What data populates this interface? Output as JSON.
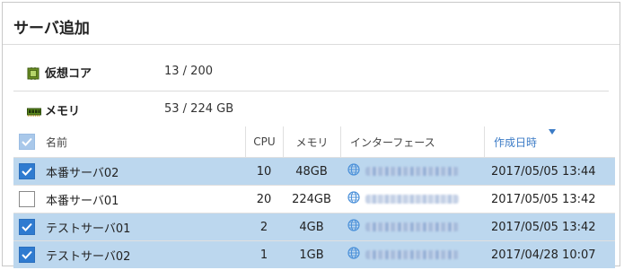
{
  "panel": {
    "title": "サーバ追加"
  },
  "summary": {
    "vcore": {
      "icon": "chip-icon",
      "label": "仮想コア",
      "value": "13 / 200"
    },
    "memory": {
      "icon": "memory-module-icon",
      "label": "メモリ",
      "value": "53 / 224 GB"
    }
  },
  "table": {
    "headers": {
      "name": "名前",
      "cpu": "CPU",
      "memory": "メモリ",
      "interface": "インターフェース",
      "created": "作成日時"
    },
    "sort": {
      "column": "created",
      "direction": "descending"
    },
    "rows": [
      {
        "selected": true,
        "name": "本番サーバ02",
        "cpu": "10",
        "memory": "48GB",
        "created": "2017/05/05 13:44"
      },
      {
        "selected": false,
        "name": "本番サーバ01",
        "cpu": "20",
        "memory": "224GB",
        "created": "2017/05/05 13:42"
      },
      {
        "selected": true,
        "name": "テストサーバ01",
        "cpu": "2",
        "memory": "4GB",
        "created": "2017/05/05 13:42"
      },
      {
        "selected": true,
        "name": "テストサーバ02",
        "cpu": "1",
        "memory": "1GB",
        "created": "2017/04/28 10:07"
      }
    ]
  },
  "colors": {
    "accent": "#2f7bd0",
    "selected_row": "#bcd7ee",
    "sort_header": "#3b7bc6"
  }
}
